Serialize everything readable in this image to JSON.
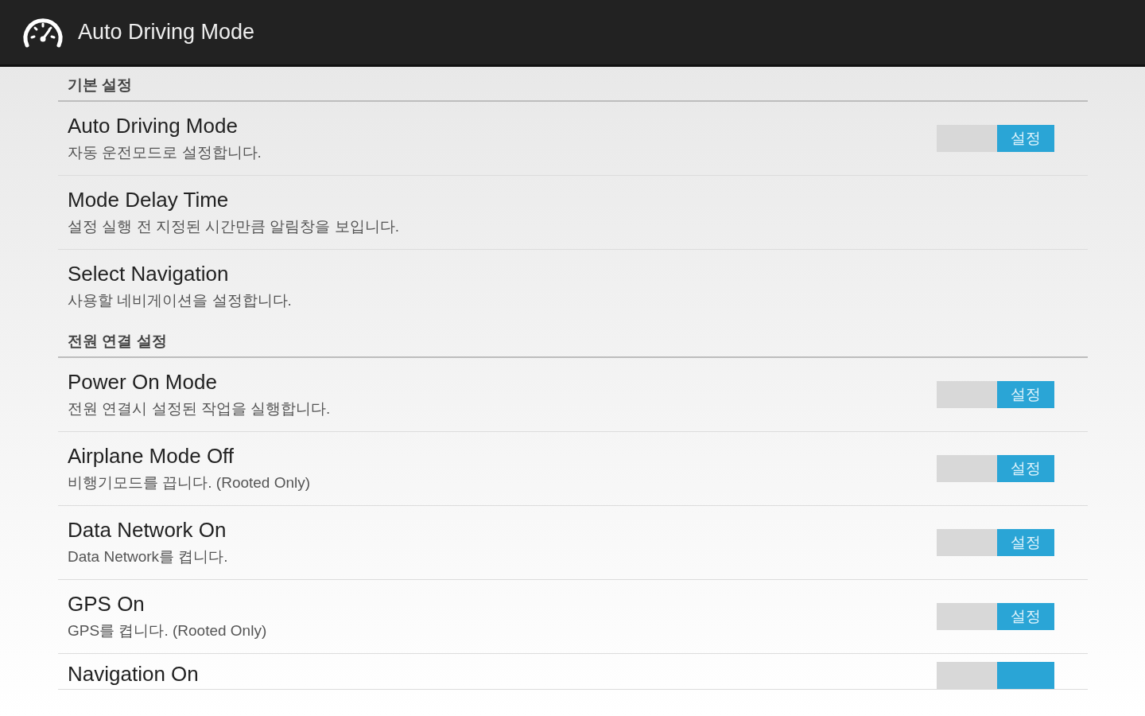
{
  "app_bar": {
    "title": "Auto Driving Mode"
  },
  "sections": [
    {
      "title": "기본 설정",
      "items": [
        {
          "kind": "toggle",
          "title": "Auto Driving Mode",
          "summary": "자동 운전모드로 설정합니다.",
          "on": true,
          "toggle_label": "설정"
        },
        {
          "kind": "plain",
          "title": "Mode Delay Time",
          "summary": "설정 실행 전 지정된 시간만큼 알림창을 보입니다."
        },
        {
          "kind": "plain",
          "title": "Select Navigation",
          "summary": "사용할 네비게이션을 설정합니다."
        }
      ]
    },
    {
      "title": "전원 연결 설정",
      "items": [
        {
          "kind": "toggle",
          "title": "Power On Mode",
          "summary": "전원 연결시 설정된 작업을 실행합니다.",
          "on": true,
          "toggle_label": "설정"
        },
        {
          "kind": "toggle",
          "title": "Airplane Mode Off",
          "summary": "비행기모드를 끕니다. (Rooted Only)",
          "on": true,
          "toggle_label": "설정"
        },
        {
          "kind": "toggle",
          "title": "Data Network On",
          "summary": "Data Network를 켭니다.",
          "on": true,
          "toggle_label": "설정"
        },
        {
          "kind": "toggle",
          "title": "GPS On",
          "summary": "GPS를 켭니다. (Rooted Only)",
          "on": true,
          "toggle_label": "설정"
        },
        {
          "kind": "toggle",
          "title": "Navigation On",
          "on": true
        }
      ]
    }
  ]
}
